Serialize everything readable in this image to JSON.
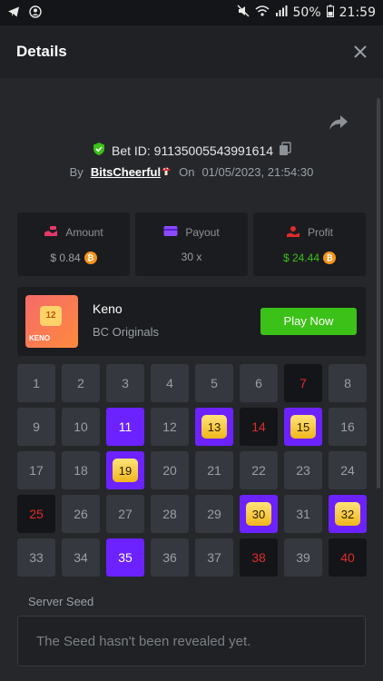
{
  "statusbar": {
    "battery": "50%",
    "time": "21:59"
  },
  "header": {
    "title": "Details"
  },
  "bet": {
    "id_label": "Bet ID: 91135005543991614",
    "by_label": "By",
    "username": "BitsCheerful",
    "on_label": "On",
    "datetime": "01/05/2023, 21:54:30"
  },
  "stats": {
    "amount": {
      "label": "Amount",
      "value": "$ 0.84"
    },
    "payout": {
      "label": "Payout",
      "value": "30 x"
    },
    "profit": {
      "label": "Profit",
      "value": "$ 24.44"
    }
  },
  "game": {
    "name": "Keno",
    "provider": "BC Originals",
    "thumb_number": "12",
    "thumb_label": "KENO",
    "play_label": "Play Now"
  },
  "tiles": [
    {
      "n": "1",
      "s": "normal"
    },
    {
      "n": "2",
      "s": "normal"
    },
    {
      "n": "3",
      "s": "normal"
    },
    {
      "n": "4",
      "s": "normal"
    },
    {
      "n": "5",
      "s": "normal"
    },
    {
      "n": "6",
      "s": "normal"
    },
    {
      "n": "7",
      "s": "miss"
    },
    {
      "n": "8",
      "s": "normal"
    },
    {
      "n": "9",
      "s": "normal"
    },
    {
      "n": "10",
      "s": "normal"
    },
    {
      "n": "11",
      "s": "purple"
    },
    {
      "n": "12",
      "s": "normal"
    },
    {
      "n": "13",
      "s": "gem"
    },
    {
      "n": "14",
      "s": "miss"
    },
    {
      "n": "15",
      "s": "gem"
    },
    {
      "n": "16",
      "s": "normal"
    },
    {
      "n": "17",
      "s": "normal"
    },
    {
      "n": "18",
      "s": "normal"
    },
    {
      "n": "19",
      "s": "gem"
    },
    {
      "n": "20",
      "s": "normal"
    },
    {
      "n": "21",
      "s": "normal"
    },
    {
      "n": "22",
      "s": "normal"
    },
    {
      "n": "23",
      "s": "normal"
    },
    {
      "n": "24",
      "s": "normal"
    },
    {
      "n": "25",
      "s": "miss"
    },
    {
      "n": "26",
      "s": "normal"
    },
    {
      "n": "27",
      "s": "normal"
    },
    {
      "n": "28",
      "s": "normal"
    },
    {
      "n": "29",
      "s": "normal"
    },
    {
      "n": "30",
      "s": "gem"
    },
    {
      "n": "31",
      "s": "normal"
    },
    {
      "n": "32",
      "s": "gem"
    },
    {
      "n": "33",
      "s": "normal"
    },
    {
      "n": "34",
      "s": "normal"
    },
    {
      "n": "35",
      "s": "purple"
    },
    {
      "n": "36",
      "s": "normal"
    },
    {
      "n": "37",
      "s": "normal"
    },
    {
      "n": "38",
      "s": "miss"
    },
    {
      "n": "39",
      "s": "normal"
    },
    {
      "n": "40",
      "s": "miss"
    }
  ],
  "seed": {
    "label": "Server Seed",
    "message": "The Seed hasn't been revealed yet."
  },
  "colors": {
    "accent_purple": "#6c22ff",
    "play_green": "#3bc117",
    "miss_red": "#e02b2b",
    "profit_green": "#3bc117"
  }
}
